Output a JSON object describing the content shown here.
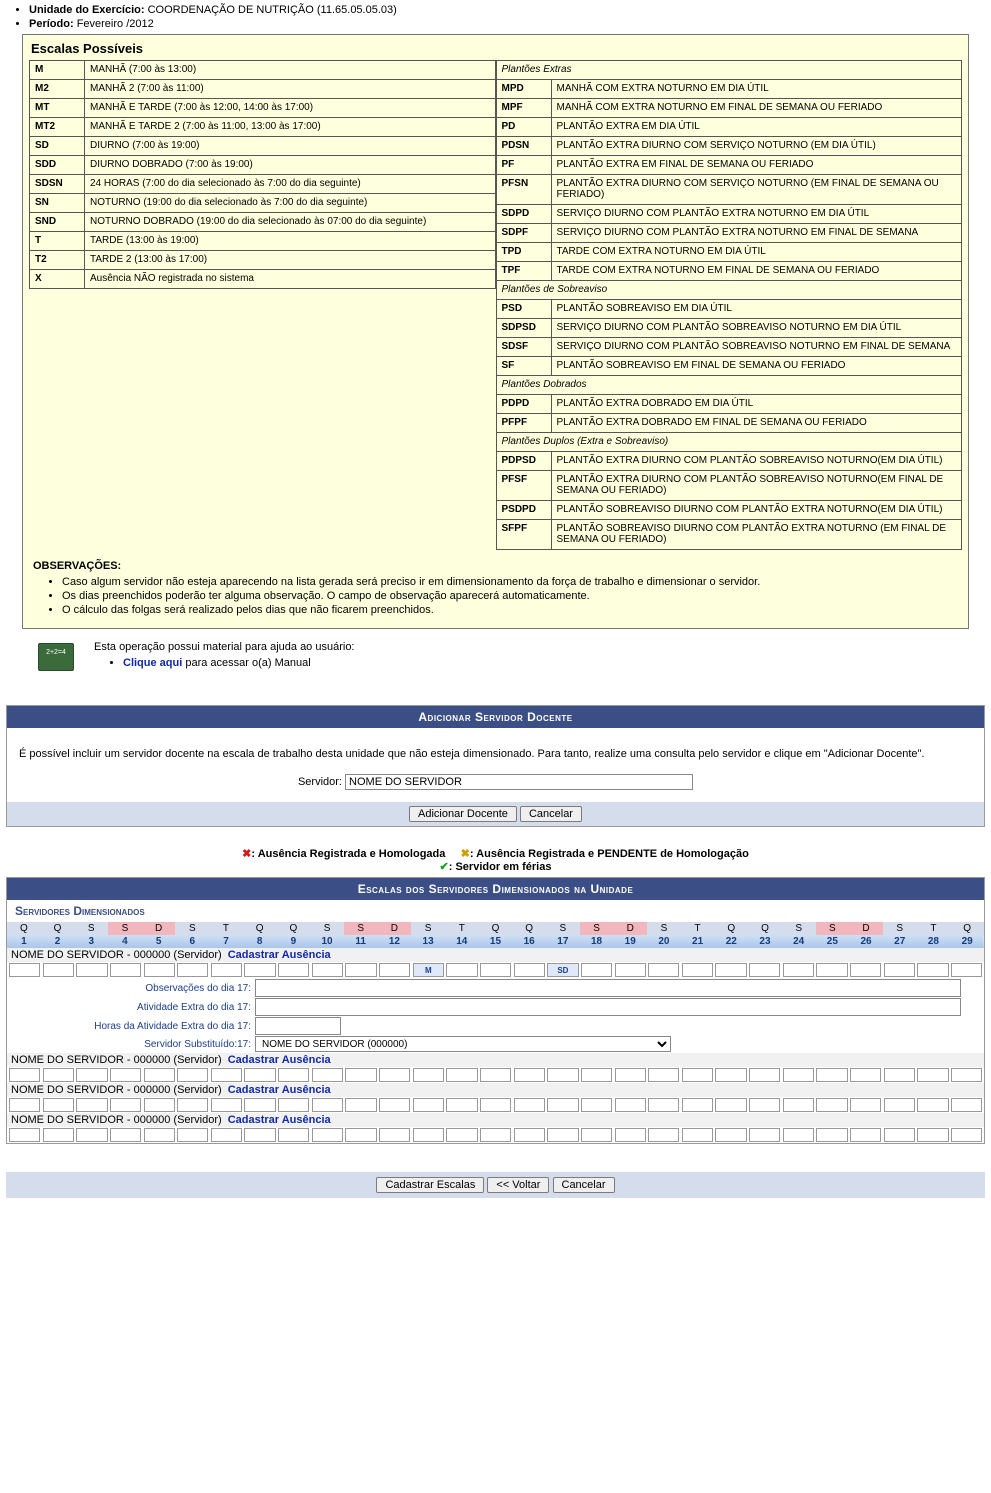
{
  "header": {
    "unidade_label": "Unidade do Exercício:",
    "unidade_value": "COORDENAÇÃO DE NUTRIÇÃO (11.65.05.05.03)",
    "periodo_label": "Período:",
    "periodo_value": "Fevereiro /2012"
  },
  "escalas": {
    "title": "Escalas Possíveis",
    "left": [
      {
        "code": "M",
        "desc": "MANHÃ (7:00 às 13:00)"
      },
      {
        "code": "M2",
        "desc": "MANHÃ 2 (7:00 às 11:00)"
      },
      {
        "code": "MT",
        "desc": "MANHÃ E TARDE (7:00 às 12:00, 14:00 às 17:00)"
      },
      {
        "code": "MT2",
        "desc": "MANHÃ E TARDE 2 (7:00 às 11:00, 13:00 às 17:00)"
      },
      {
        "code": "SD",
        "desc": "DIURNO (7:00 às 19:00)"
      },
      {
        "code": "SDD",
        "desc": "DIURNO DOBRADO (7:00 às 19:00)"
      },
      {
        "code": "SDSN",
        "desc": "24 HORAS (7:00 do dia selecionado às 7:00 do dia seguinte)"
      },
      {
        "code": "SN",
        "desc": "NOTURNO (19:00 do dia selecionado às 7:00 do dia seguinte)"
      },
      {
        "code": "SND",
        "desc": "NOTURNO DOBRADO (19:00 do dia selecionado às 07:00 do dia seguinte)"
      },
      {
        "code": "T",
        "desc": "TARDE (13:00 às 19:00)"
      },
      {
        "code": "T2",
        "desc": "TARDE 2 (13:00 às 17:00)"
      },
      {
        "code": "X",
        "desc": "Ausência NÃO registrada no sistema"
      }
    ],
    "grp_extras": "Plantões Extras",
    "extras": [
      {
        "code": "MPD",
        "desc": "MANHÃ COM EXTRA NOTURNO EM DIA ÚTIL"
      },
      {
        "code": "MPF",
        "desc": "MANHÃ COM EXTRA NOTURNO EM FINAL DE SEMANA OU FERIADO"
      },
      {
        "code": "PD",
        "desc": "PLANTÃO EXTRA EM DIA ÚTIL"
      },
      {
        "code": "PDSN",
        "desc": "PLANTÃO EXTRA DIURNO COM SERVIÇO NOTURNO (EM DIA ÚTIL)"
      },
      {
        "code": "PF",
        "desc": "PLANTÃO EXTRA EM FINAL DE SEMANA OU FERIADO"
      },
      {
        "code": "PFSN",
        "desc": "PLANTÃO EXTRA DIURNO COM SERVIÇO NOTURNO (EM FINAL DE SEMANA OU FERIADO)"
      },
      {
        "code": "SDPD",
        "desc": "SERVIÇO DIURNO COM PLANTÃO EXTRA NOTURNO EM DIA ÚTIL"
      },
      {
        "code": "SDPF",
        "desc": "SERVIÇO DIURNO COM PLANTÃO EXTRA NOTURNO EM FINAL DE SEMANA"
      },
      {
        "code": "TPD",
        "desc": "TARDE COM EXTRA NOTURNO EM DIA ÚTIL"
      },
      {
        "code": "TPF",
        "desc": "TARDE COM EXTRA NOTURNO EM FINAL DE SEMANA OU FERIADO"
      }
    ],
    "grp_sobre": "Plantões de Sobreaviso",
    "sobre": [
      {
        "code": "PSD",
        "desc": "PLANTÃO SOBREAVISO EM DIA ÚTIL"
      },
      {
        "code": "SDPSD",
        "desc": "SERVIÇO DIURNO COM PLANTÃO SOBREAVISO NOTURNO EM DIA ÚTIL"
      },
      {
        "code": "SDSF",
        "desc": "SERVIÇO DIURNO COM PLANTÃO SOBREAVISO NOTURNO EM FINAL DE SEMANA"
      },
      {
        "code": "SF",
        "desc": "PLANTÃO SOBREAVISO EM FINAL DE SEMANA OU FERIADO"
      }
    ],
    "grp_dobrados": "Plantões Dobrados",
    "dobrados": [
      {
        "code": "PDPD",
        "desc": "PLANTÃO EXTRA DOBRADO EM DIA ÚTIL"
      },
      {
        "code": "PFPF",
        "desc": "PLANTÃO EXTRA DOBRADO EM FINAL DE SEMANA OU FERIADO"
      }
    ],
    "grp_duplos": "Plantões Duplos (Extra e Sobreaviso)",
    "duplos": [
      {
        "code": "PDPSD",
        "desc": "PLANTÃO EXTRA DIURNO COM PLANTÃO SOBREAVISO NOTURNO(EM DIA ÚTIL)"
      },
      {
        "code": "PFSF",
        "desc": "PLANTÃO EXTRA DIURNO COM PLANTÃO SOBREAVISO NOTURNO(EM FINAL DE SEMANA OU FERIADO)"
      },
      {
        "code": "PSDPD",
        "desc": "PLANTÃO SOBREAVISO DIURNO COM PLANTÃO EXTRA NOTURNO(EM DIA ÚTIL)"
      },
      {
        "code": "SFPF",
        "desc": "PLANTÃO SOBREAVISO DIURNO COM PLANTÃO EXTRA NOTURNO (EM FINAL DE SEMANA OU FERIADO)"
      }
    ]
  },
  "obs": {
    "title": "OBSERVAÇÕES:",
    "items": [
      "Caso algum servidor não esteja aparecendo na lista gerada será preciso ir em dimensionamento da força de trabalho e dimensionar o servidor.",
      "Os dias preenchidos poderão ter alguma observação. O campo de observação aparecerá automaticamente.",
      "O cálculo das folgas será realizado pelos dias que não ficarem preenchidos."
    ]
  },
  "help": {
    "text": "Esta operação possui material para ajuda ao usuário:",
    "link": "Clique aqui",
    "after": " para acessar o(a) Manual"
  },
  "add": {
    "bar": "Adicionar Servidor Docente",
    "text": "É possível incluir um servidor docente na escala de trabalho desta unidade que não esteja dimensionado. Para tanto, realize uma consulta pelo servidor e clique em \"Adicionar Docente\".",
    "label": "Servidor:",
    "input": "NOME DO SERVIDOR",
    "btn_add": "Adicionar Docente",
    "btn_cancel": "Cancelar"
  },
  "legend": {
    "l1": ": Ausência Registrada e Homologada",
    "l2": ": Ausência Registrada e PENDENTE de Homologação",
    "l3": ": Servidor em férias"
  },
  "grid": {
    "bar": "Escalas dos Servidores Dimensionados na Unidade",
    "sub": "Servidores Dimensionados",
    "dow": [
      "Q",
      "Q",
      "S",
      "S",
      "D",
      "S",
      "T",
      "Q",
      "Q",
      "S",
      "S",
      "D",
      "S",
      "T",
      "Q",
      "Q",
      "S",
      "S",
      "D",
      "S",
      "T",
      "Q",
      "Q",
      "S",
      "S",
      "D",
      "S",
      "T",
      "Q"
    ],
    "wk_idx": [
      3,
      4,
      10,
      11,
      17,
      18,
      24,
      25
    ],
    "nums": [
      "1",
      "2",
      "3",
      "4",
      "5",
      "6",
      "7",
      "8",
      "9",
      "10",
      "11",
      "12",
      "13",
      "14",
      "15",
      "16",
      "17",
      "18",
      "19",
      "20",
      "21",
      "22",
      "23",
      "24",
      "25",
      "26",
      "27",
      "28",
      "29"
    ],
    "serv_name": "NOME DO SERVIDOR - 000000 (Servidor)",
    "cad_link": "Cadastrar Ausência",
    "row1": {
      "cells": [
        "",
        "",
        "",
        "",
        "",
        "",
        "",
        "",
        "",
        "",
        "",
        "",
        "M",
        "",
        "",
        "",
        "SD",
        "",
        "",
        "",
        "",
        "",
        "",
        "",
        "",
        "",
        "",
        "",
        ""
      ]
    },
    "f_obs": "Observações do dia 17:",
    "f_ativ": "Atividade Extra do dia 17:",
    "f_horas": "Horas da Atividade Extra do dia 17:",
    "f_sub": "Servidor Substituído:17:",
    "sub_opt": "NOME DO SERVIDOR (000000)"
  },
  "footer": {
    "b1": "Cadastrar Escalas",
    "b2": "<< Voltar",
    "b3": "Cancelar"
  }
}
